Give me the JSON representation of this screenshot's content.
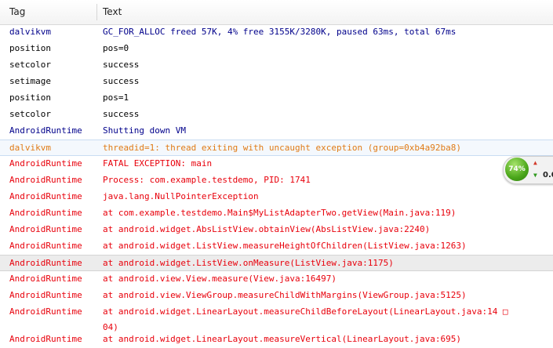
{
  "header": {
    "tag": "Tag",
    "text": "Text"
  },
  "colors": {
    "verbose": "#000000",
    "debug": "#00008b",
    "warn": "#e07b16",
    "error": "#e8000b"
  },
  "rows": [
    {
      "tag": "dalvikvm",
      "text": "GC_FOR_ALLOC freed 57K, 4% free 3155K/3280K, paused 63ms, total 67ms",
      "level": "debug"
    },
    {
      "tag": "position",
      "text": "pos=0",
      "level": "verbose"
    },
    {
      "tag": "setcolor",
      "text": "success",
      "level": "verbose"
    },
    {
      "tag": "setimage",
      "text": "success",
      "level": "verbose"
    },
    {
      "tag": "position",
      "text": "pos=1",
      "level": "verbose"
    },
    {
      "tag": "setcolor",
      "text": "success",
      "level": "verbose"
    },
    {
      "tag": "AndroidRuntime",
      "text": "Shutting down VM",
      "level": "debug"
    },
    {
      "tag": "dalvikvm",
      "text": "threadid=1: thread exiting with uncaught exception (group=0xb4a92ba8)",
      "level": "warn",
      "state": "hl"
    },
    {
      "tag": "AndroidRuntime",
      "text": "FATAL EXCEPTION: main",
      "level": "error"
    },
    {
      "tag": "AndroidRuntime",
      "text": "Process: com.example.testdemo, PID: 1741",
      "level": "error"
    },
    {
      "tag": "AndroidRuntime",
      "text": "java.lang.NullPointerException",
      "level": "error"
    },
    {
      "tag": "AndroidRuntime",
      "text": "at com.example.testdemo.Main$MyListAdapterTwo.getView(Main.java:119)",
      "level": "error"
    },
    {
      "tag": "AndroidRuntime",
      "text": "at android.widget.AbsListView.obtainView(AbsListView.java:2240)",
      "level": "error"
    },
    {
      "tag": "AndroidRuntime",
      "text": "at android.widget.ListView.measureHeightOfChildren(ListView.java:1263)",
      "level": "error"
    },
    {
      "tag": "AndroidRuntime",
      "text": "at android.widget.ListView.onMeasure(ListView.java:1175)",
      "level": "error",
      "state": "sel"
    },
    {
      "tag": "AndroidRuntime",
      "text": "at android.view.View.measure(View.java:16497)",
      "level": "error"
    },
    {
      "tag": "AndroidRuntime",
      "text": "at android.view.ViewGroup.measureChildWithMargins(ViewGroup.java:5125)",
      "level": "error"
    },
    {
      "tag": "AndroidRuntime",
      "text": "at android.widget.LinearLayout.measureChildBeforeLayout(LinearLayout.java:14 □\n04)",
      "level": "error",
      "tall": true
    },
    {
      "tag": "AndroidRuntime",
      "text": "at android.widget.LinearLayout.measureVertical(LinearLayout.java:695)",
      "level": "error"
    }
  ],
  "widget": {
    "percent": "74%",
    "up_arrow": "arrow-up-icon",
    "down_arrow": "arrow-down-icon",
    "speed": "0.0"
  }
}
